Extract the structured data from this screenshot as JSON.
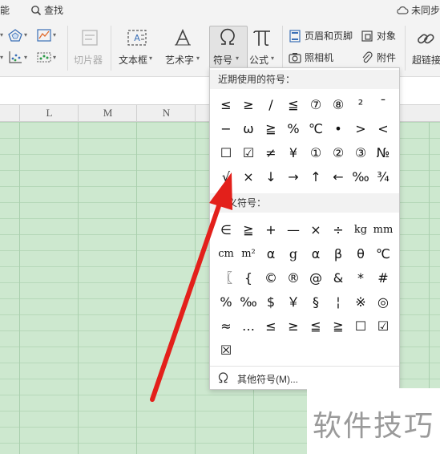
{
  "topbar": {
    "left_fragment": "能",
    "find_label": "查找",
    "sync_label": "未同步"
  },
  "ribbon": {
    "slicer": "切片器",
    "textbox": "文本框",
    "wordart": "艺术字",
    "symbol": "符号",
    "formula": "公式",
    "header_footer": "页眉和页脚",
    "object": "对象",
    "camera": "照相机",
    "attachment": "附件",
    "hyperlink": "超链接"
  },
  "columns": [
    "L",
    "M",
    "N"
  ],
  "symbol_panel": {
    "recent_title": "近期使用的符号：",
    "recent_symbols": [
      "≤",
      "≥",
      "/",
      "≦",
      "⑦",
      "⑧",
      "²",
      "¯",
      "−",
      "ω",
      "≧",
      "%",
      "℃",
      "•",
      ">",
      "<",
      "☐",
      "☑",
      "≠",
      "¥",
      "①",
      "②",
      "③",
      "№",
      "√",
      "×",
      "↓",
      "→",
      "↑",
      "←",
      "‰",
      "¾"
    ],
    "custom_title": "定义符号：",
    "custom_symbols": [
      "∈",
      "≧",
      "+",
      "—",
      "×",
      "÷",
      "kg",
      "mm",
      "cm",
      "m²",
      "α",
      "g",
      "α",
      "β",
      "θ",
      "℃",
      "〖",
      "{",
      "©",
      "®",
      "@",
      "&",
      "*",
      "#",
      "%",
      "‰",
      "$",
      "￥",
      "§",
      "¦",
      "※",
      "◎",
      "≈",
      "…",
      "≤",
      "≥",
      "≦",
      "≧",
      "☐",
      "☑",
      "☒"
    ],
    "more_label": "其他符号(M)..."
  },
  "watermark": "软件技巧",
  "colors": {
    "sheet_green": "#cde8cf",
    "arrow_red": "#e3201b"
  }
}
